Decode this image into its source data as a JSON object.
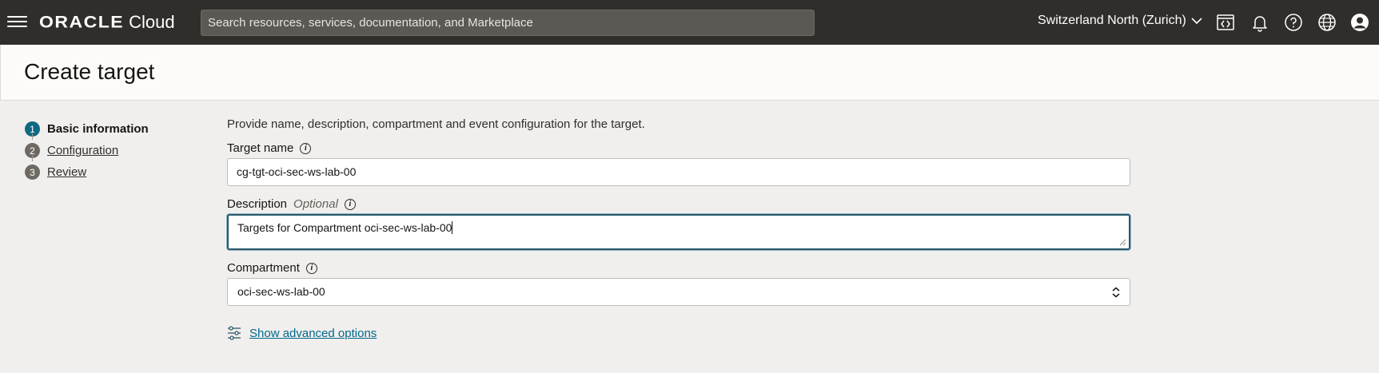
{
  "header": {
    "logo_brand": "ORACLE",
    "logo_product": "Cloud",
    "search_placeholder": "Search resources, services, documentation, and Marketplace",
    "region": "Switzerland North (Zurich)",
    "icons": [
      "developer-tools-icon",
      "bell-icon",
      "help-icon",
      "globe-icon",
      "user-profile-icon"
    ],
    "bar_color": "#312d2a"
  },
  "page": {
    "title": "Create target"
  },
  "steps": [
    {
      "number": "1",
      "label": "Basic information",
      "active": true
    },
    {
      "number": "2",
      "label": "Configuration",
      "active": false
    },
    {
      "number": "3",
      "label": "Review",
      "active": false
    }
  ],
  "form": {
    "intro": "Provide name, description, compartment and event configuration for the target.",
    "target_name": {
      "label": "Target name",
      "value": "cg-tgt-oci-sec-ws-lab-00"
    },
    "description": {
      "label": "Description",
      "optional": "Optional",
      "value": "Targets for Compartment oci-sec-ws-lab-00"
    },
    "compartment": {
      "label": "Compartment",
      "value": "oci-sec-ws-lab-00"
    },
    "advanced_link": "Show advanced options"
  },
  "colors": {
    "accent": "#0d6981",
    "link": "#00688c",
    "page_bg": "#f1efed"
  }
}
